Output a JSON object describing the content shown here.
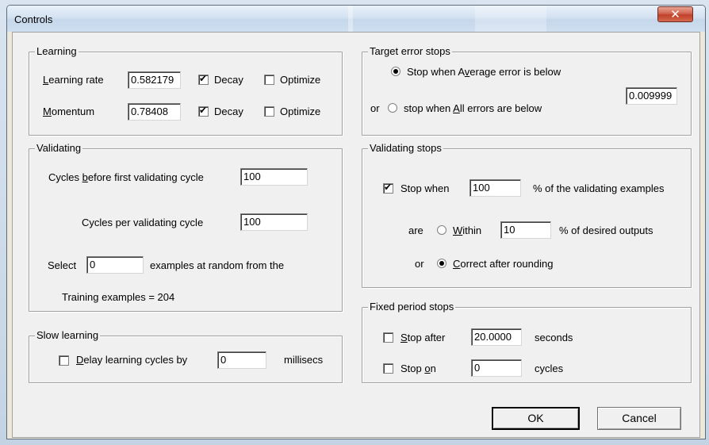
{
  "window": {
    "title": "Controls"
  },
  "learning": {
    "legend": "Learning",
    "rate_label_pre": "",
    "rate_label_u": "L",
    "rate_label_post": "earning rate",
    "rate_value": "0.582179",
    "mom_label_u": "M",
    "mom_label_post": "omentum",
    "mom_value": "0.78408",
    "decay_label": "Decay",
    "optimize_label": "Optimize"
  },
  "validating": {
    "legend": "Validating",
    "cycles_first_pre": "Cycles ",
    "cycles_first_u": "b",
    "cycles_first_post": "efore first validating cycle",
    "cycles_first_value": "100",
    "cycles_per_label": "Cycles per validating cycle",
    "cycles_per_value": "100",
    "select_label": "Select",
    "select_value": "0",
    "select_suffix": "examples at random from the",
    "training_examples": "Training examples = 204"
  },
  "slow": {
    "legend": "Slow learning",
    "delay_u": "D",
    "delay_post": "elay learning cycles by",
    "delay_value": "0",
    "delay_units": "millisecs"
  },
  "target": {
    "legend": "Target error stops",
    "avg_pre": "Stop when A",
    "avg_u": "v",
    "avg_post": "erage error is below",
    "or_label": "or",
    "all_pre": "stop when ",
    "all_u": "A",
    "all_post": "ll errors are below",
    "error_value": "0.009999"
  },
  "valstops": {
    "legend": "Validating stops",
    "stop_when": "Stop when",
    "stop_pct_value": "100",
    "stop_suffix": "% of the validating examples",
    "are_label": "are",
    "within_u": "W",
    "within_post": "ithin",
    "within_value": "10",
    "within_suffix": "% of desired outputs",
    "or_label": "or",
    "correct_u": "C",
    "correct_post": "orrect after rounding"
  },
  "fixed": {
    "legend": "Fixed period stops",
    "stop_after_u": "S",
    "stop_after_post": "top after",
    "seconds_value": "20.0000",
    "seconds_label": "seconds",
    "stop_on_pre": "Stop ",
    "stop_on_u": "o",
    "stop_on_post": "n",
    "cycles_value": "0",
    "cycles_label": "cycles"
  },
  "buttons": {
    "ok": "OK",
    "cancel": "Cancel"
  }
}
